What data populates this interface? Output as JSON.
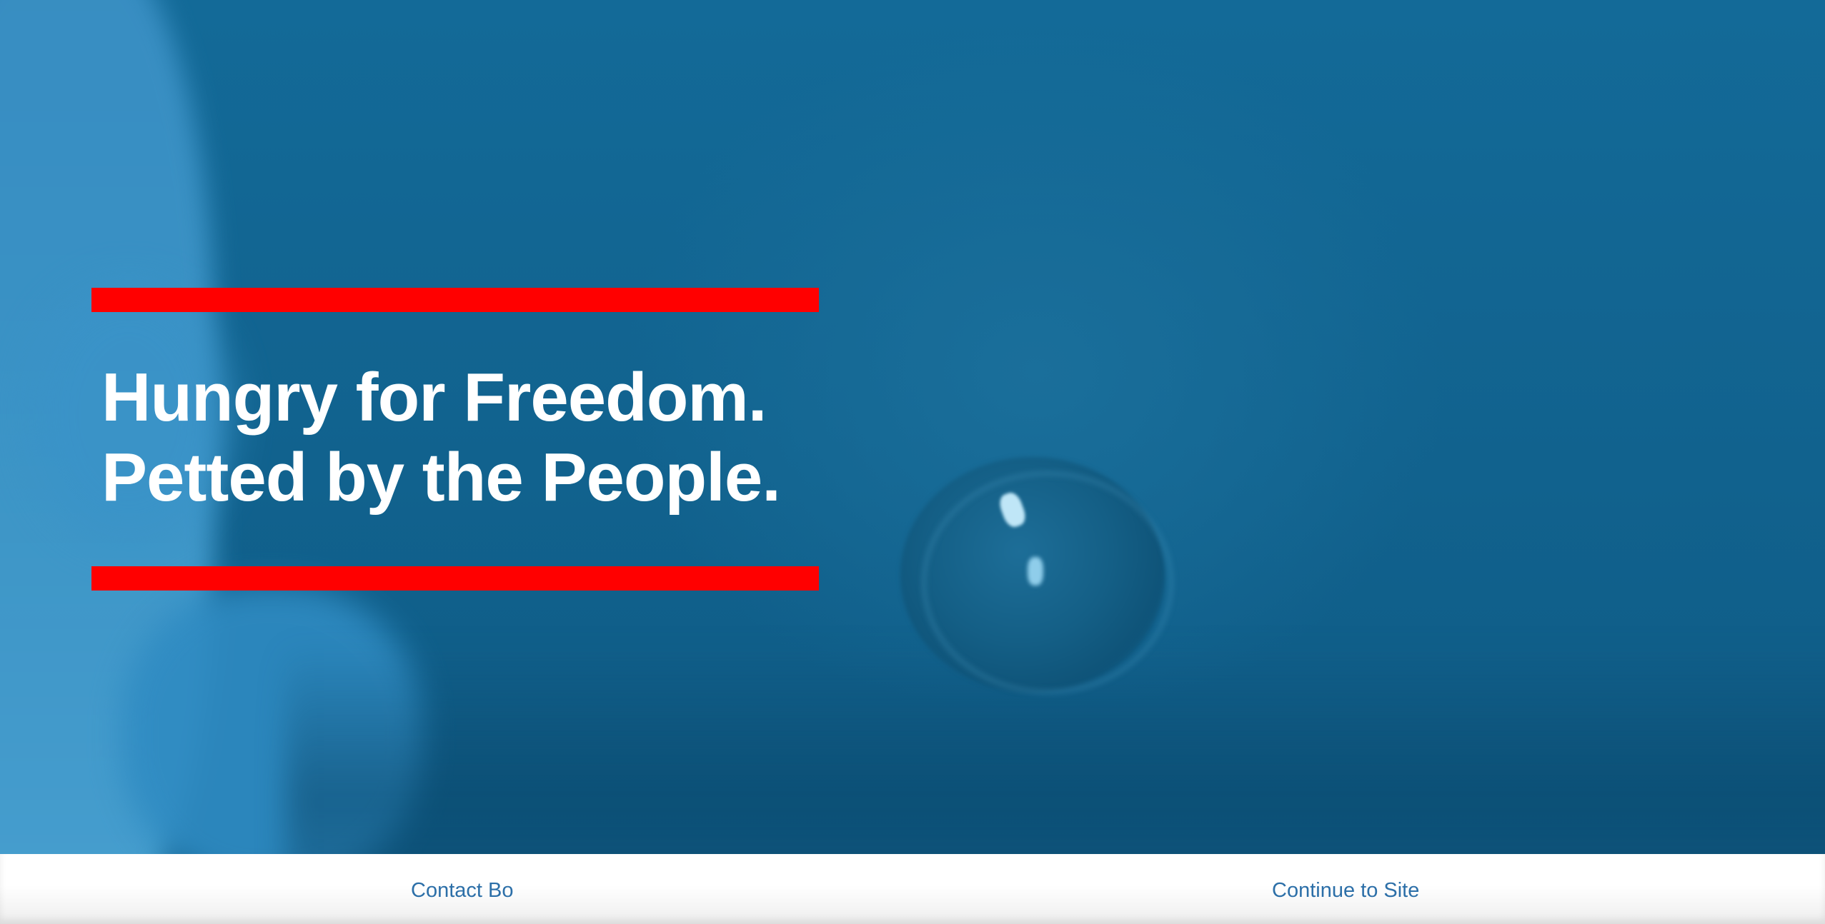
{
  "hero": {
    "tagline_line_1": "Hungry for Freedom.",
    "tagline_line_2": "Petted by the People.",
    "accent_color": "#ff0000",
    "overlay_color": "#136a98",
    "text_color": "#ffffff"
  },
  "footer": {
    "contact_label": "Contact Bo",
    "continue_label": "Continue to Site",
    "link_color": "#2c6fa8"
  }
}
